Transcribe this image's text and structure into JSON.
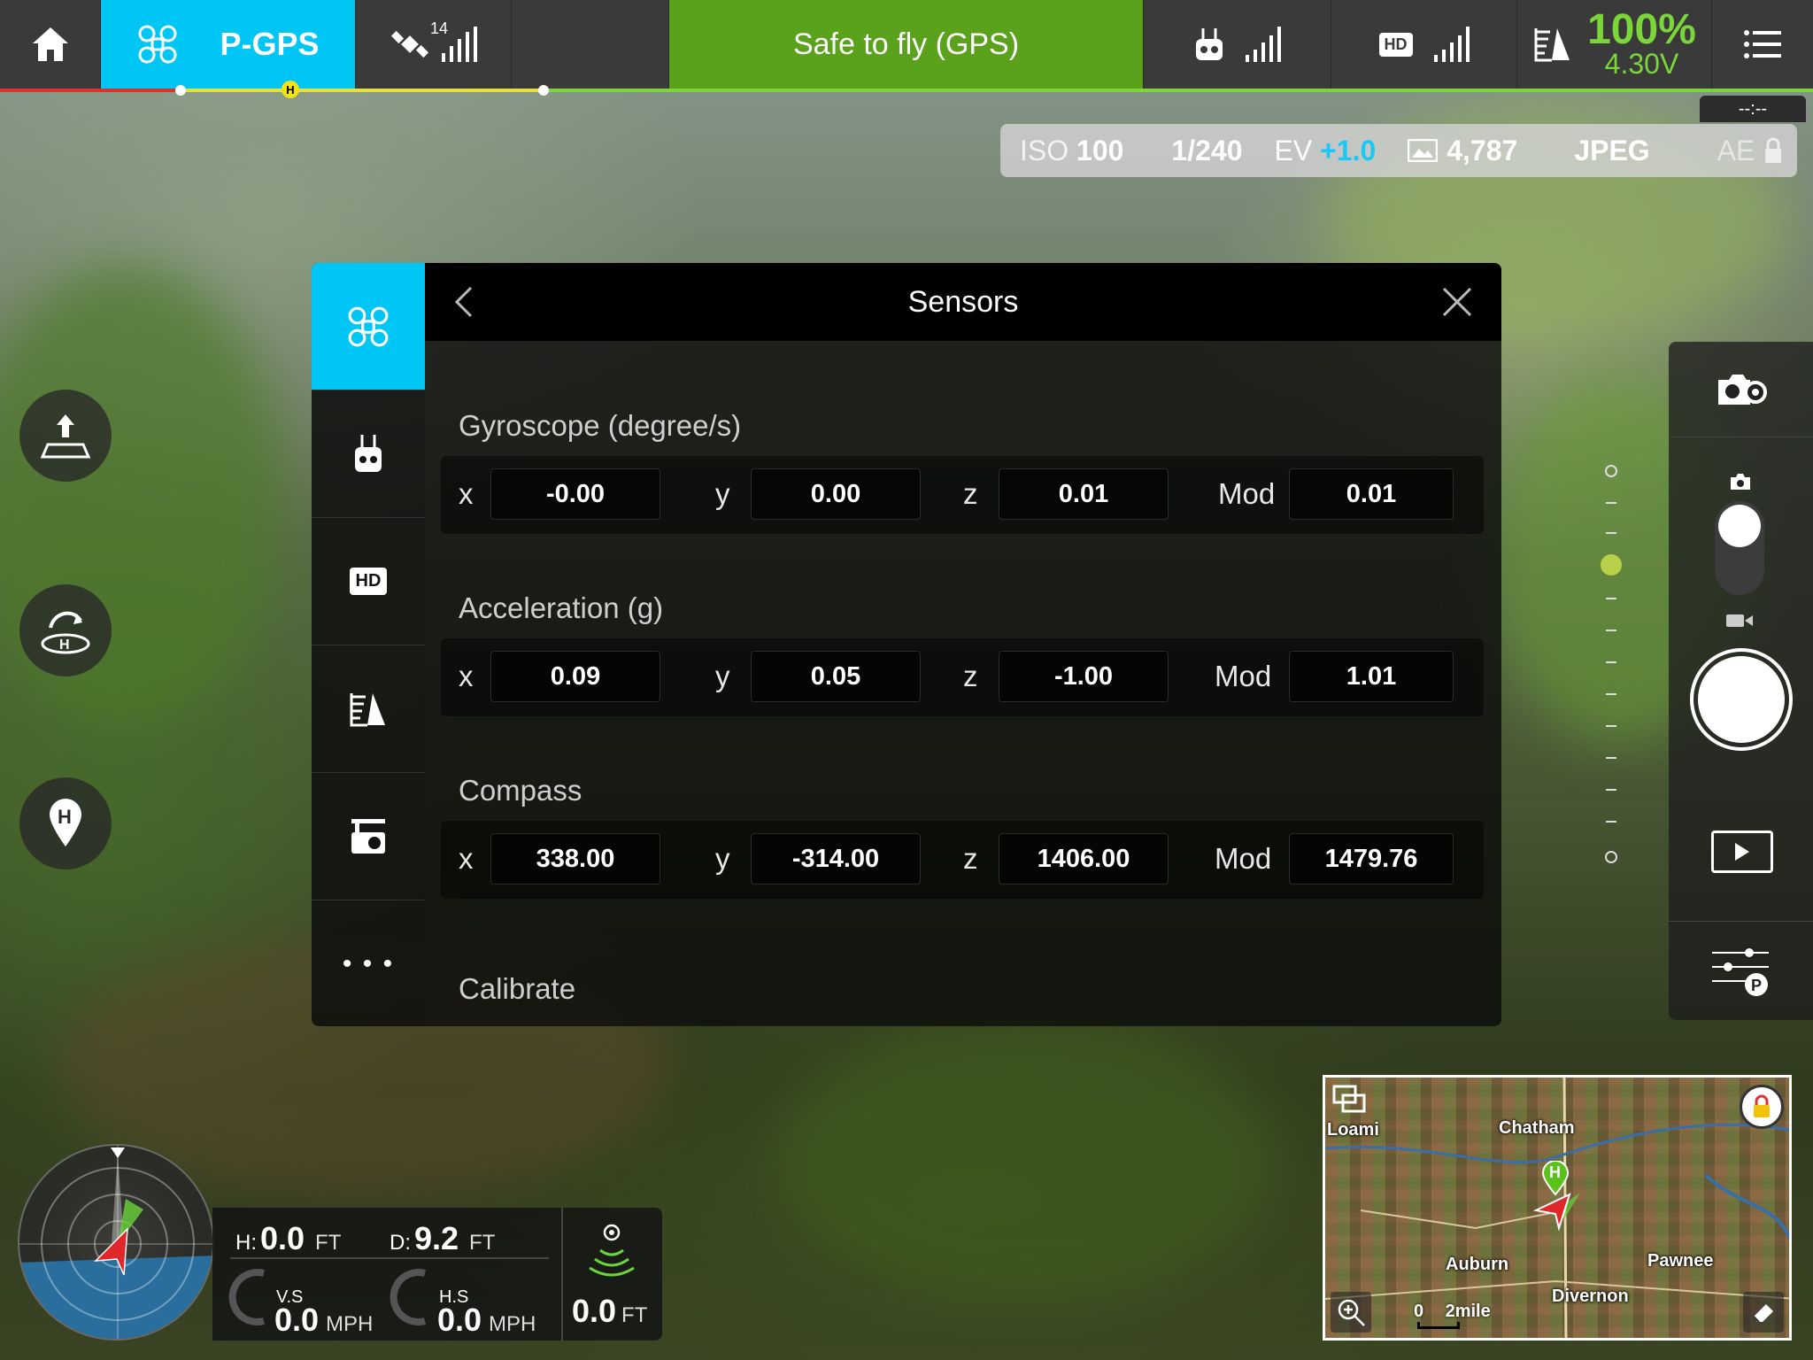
{
  "topbar": {
    "flight_mode": "P-GPS",
    "satellite_count": "14",
    "status": "Safe to fly (GPS)",
    "battery_percent": "100%",
    "battery_voltage": "4.30V",
    "home_marker": "H",
    "hd_badge": "HD"
  },
  "timer": "--:--",
  "camera_bar": {
    "iso_label": "ISO",
    "iso_value": "100",
    "shutter": "1/240",
    "ev_label": "EV",
    "ev_value": "+1.0",
    "capacity": "4,787",
    "format": "JPEG",
    "ae_label": "AE"
  },
  "sidebar_icons": [
    "aircraft-icon",
    "remote-controller-icon",
    "hd-icon",
    "battery-icon",
    "gimbal-icon",
    "more-icon"
  ],
  "sensors_panel": {
    "title": "Sensors",
    "hd_label": "HD",
    "more_label": "• • •",
    "gyroscope": {
      "title": "Gyroscope (degree/s)",
      "x_label": "x",
      "y_label": "y",
      "z_label": "z",
      "mod_label": "Mod",
      "x": "-0.00",
      "y": "0.00",
      "z": "0.01",
      "mod": "0.01"
    },
    "acceleration": {
      "title": "Acceleration (g)",
      "x_label": "x",
      "y_label": "y",
      "z_label": "z",
      "mod_label": "Mod",
      "x": "0.09",
      "y": "0.05",
      "z": "-1.00",
      "mod": "1.01"
    },
    "compass": {
      "title": "Compass",
      "x_label": "x",
      "y_label": "y",
      "z_label": "z",
      "mod_label": "Mod",
      "x": "338.00",
      "y": "-314.00",
      "z": "1406.00",
      "mod": "1479.76"
    },
    "calibrate_label": "Calibrate"
  },
  "map": {
    "labels": [
      "Loami",
      "Chatham",
      "Auburn",
      "Pawnee",
      "Divernon"
    ],
    "scale_zero": "0",
    "scale_label": "2mile",
    "home_marker": "H"
  },
  "telemetry": {
    "h_label": "H:",
    "h_value": "0.0",
    "h_unit": "FT",
    "d_label": "D:",
    "d_value": "9.2",
    "d_unit": "FT",
    "vs_label": "V.S",
    "vs_value": "0.0",
    "vs_unit": "MPH",
    "hs_label": "H.S",
    "hs_value": "0.0",
    "hs_unit": "MPH",
    "vps_value": "0.0",
    "vps_unit": "FT"
  },
  "colors": {
    "accent": "#00c6f5",
    "status_green": "#5aa21c",
    "battery_green": "#7bd63a",
    "ev_blue": "#1ac8f7"
  }
}
